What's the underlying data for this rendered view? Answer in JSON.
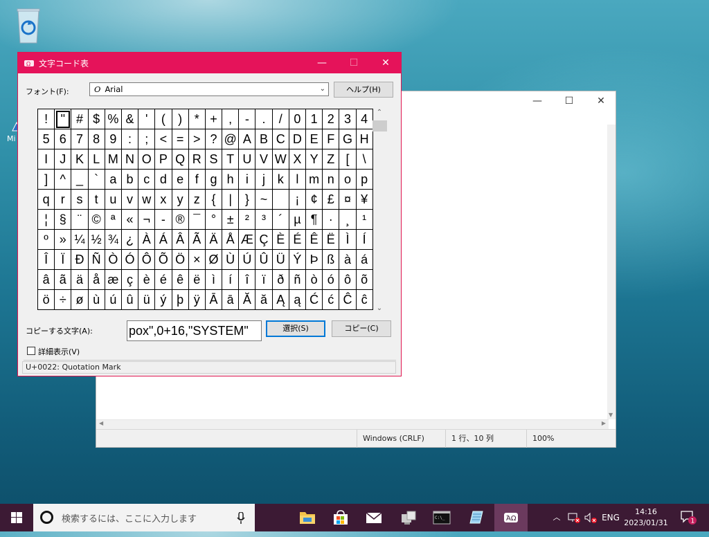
{
  "desktop": {
    "stub_label": "Mi"
  },
  "notepad": {
    "status": {
      "encoding": "Windows (CRLF)",
      "position": "1 行、10 列",
      "zoom": "100%"
    }
  },
  "charmap": {
    "title": "文字コード表",
    "font_label": "フォント(F):",
    "font_value": "Arial",
    "help_button": "ヘルプ(H)",
    "grid": [
      "!",
      "\"",
      "#",
      "$",
      "%",
      "&",
      "'",
      "(",
      ")",
      "*",
      "+",
      ",",
      "-",
      ".",
      "/",
      "0",
      "1",
      "2",
      "3",
      "4",
      "5",
      "6",
      "7",
      "8",
      "9",
      ":",
      ";",
      "<",
      "=",
      ">",
      "?",
      "@",
      "A",
      "B",
      "C",
      "D",
      "E",
      "F",
      "G",
      "H",
      "I",
      "J",
      "K",
      "L",
      "M",
      "N",
      "O",
      "P",
      "Q",
      "R",
      "S",
      "T",
      "U",
      "V",
      "W",
      "X",
      "Y",
      "Z",
      "[",
      "\\",
      "]",
      "^",
      "_",
      "`",
      "a",
      "b",
      "c",
      "d",
      "e",
      "f",
      "g",
      "h",
      "i",
      "j",
      "k",
      "l",
      "m",
      "n",
      "o",
      "p",
      "q",
      "r",
      "s",
      "t",
      "u",
      "v",
      "w",
      "x",
      "y",
      "z",
      "{",
      "|",
      "}",
      "~",
      " ",
      "¡",
      "¢",
      "£",
      "¤",
      "¥",
      "¦",
      "§",
      "¨",
      "©",
      "ª",
      "«",
      "¬",
      "-",
      "®",
      "¯",
      "°",
      "±",
      "²",
      "³",
      "´",
      "µ",
      "¶",
      "·",
      "¸",
      "¹",
      "º",
      "»",
      "¼",
      "½",
      "¾",
      "¿",
      "À",
      "Á",
      "Â",
      "Ã",
      "Ä",
      "Å",
      "Æ",
      "Ç",
      "È",
      "É",
      "Ê",
      "Ë",
      "Ì",
      "Í",
      "Î",
      "Ï",
      "Ð",
      "Ñ",
      "Ò",
      "Ó",
      "Ô",
      "Õ",
      "Ö",
      "×",
      "Ø",
      "Ù",
      "Ú",
      "Û",
      "Ü",
      "Ý",
      "Þ",
      "ß",
      "à",
      "á",
      "â",
      "ã",
      "ä",
      "å",
      "æ",
      "ç",
      "è",
      "é",
      "ê",
      "ë",
      "ì",
      "í",
      "î",
      "ï",
      "ð",
      "ñ",
      "ò",
      "ó",
      "ô",
      "õ",
      "ö",
      "÷",
      "ø",
      "ù",
      "ú",
      "û",
      "ü",
      "ý",
      "þ",
      "ÿ",
      "Ā",
      "ā",
      "Ă",
      "ă",
      "Ą",
      "ą",
      "Ć",
      "ć",
      "Ĉ",
      "ĉ"
    ],
    "selected_index": 1,
    "copy_label": "コピーする文字(A):",
    "copy_value": "pox\",0+16,\"SYSTEM\"",
    "select_button": "選択(S)",
    "copy_button": "コピー(C)",
    "advanced_label": "詳細表示(V)",
    "advanced_checked": false,
    "status_text": "U+0022: Quotation Mark"
  },
  "taskbar": {
    "search_placeholder": "検索するには、ここに入力します",
    "lang": "ENG",
    "time": "14:16",
    "date": "2023/01/31",
    "notification_count": "1"
  },
  "colors": {
    "accent": "#e5135a",
    "taskbar": "#3c1a34"
  }
}
